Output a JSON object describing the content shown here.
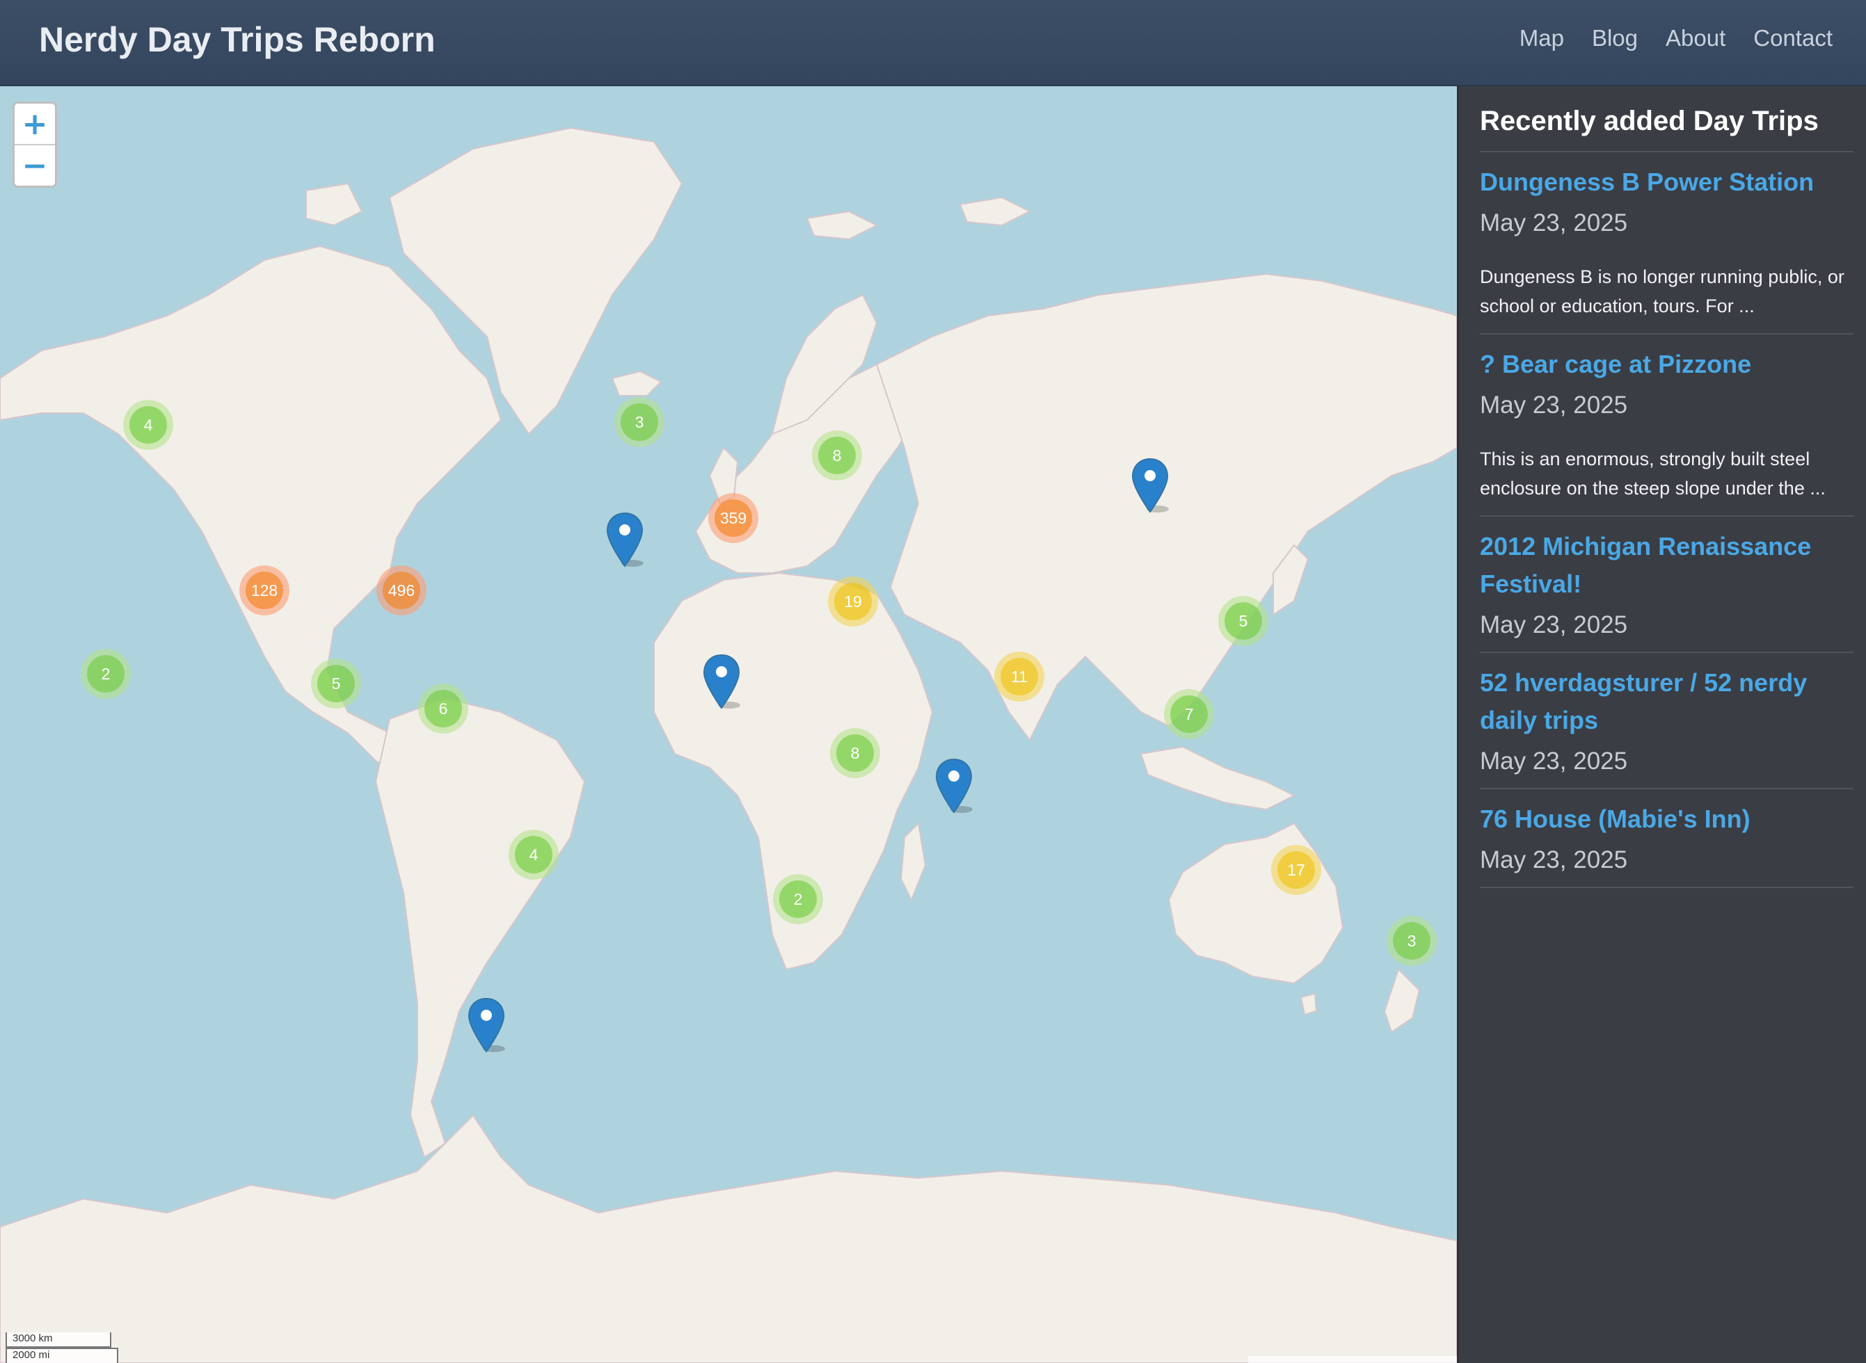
{
  "navbar": {
    "brand": "Nerdy Day Trips Reborn",
    "links": [
      "Map",
      "Blog",
      "About",
      "Contact"
    ]
  },
  "map": {
    "zoom_in": "+",
    "zoom_out": "−",
    "scale_km": "3000 km",
    "scale_mi": "2000 mi",
    "clusters": [
      "4",
      "128",
      "496",
      "2",
      "5",
      "6",
      "3",
      "359",
      "8",
      "19",
      "11",
      "8",
      "4",
      "2",
      "5",
      "7",
      "17",
      "3"
    ],
    "colors": {
      "water": "#aed3df",
      "land": "#f2efe9",
      "pin": "#2a81cb"
    }
  },
  "sidebar": {
    "title": "Recently added Day Trips",
    "trips": [
      {
        "title": "Dungeness B Power Station",
        "date": "May 23, 2025",
        "desc": "Dungeness B is no longer running public, or school or education, tours. For ..."
      },
      {
        "title": "? Bear cage at Pizzone",
        "date": "May 23, 2025",
        "desc": "This is an enormous, strongly built steel enclosure on the steep slope under the ..."
      },
      {
        "title": "2012 Michigan Renaissance Festival!",
        "date": "May 23, 2025"
      },
      {
        "title": "52 hverdagsturer / 52 nerdy daily trips",
        "date": "May 23, 2025"
      },
      {
        "title": "76 House (Mabie's Inn)",
        "date": "May 23, 2025"
      }
    ]
  }
}
